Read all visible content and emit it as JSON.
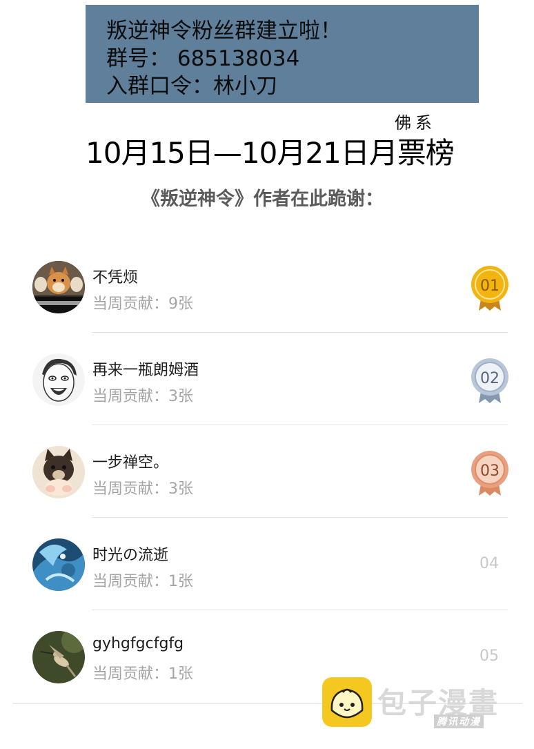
{
  "banner": {
    "line1": "叛逆神令粉丝群建立啦！",
    "line2": "群号： 685138034",
    "line3": "入群口令：林小刀"
  },
  "header": {
    "note": "佛系",
    "title": "10月15日—10月21日月票榜",
    "subtitle": "《叛逆神令》作者在此跪谢："
  },
  "leaderboard": [
    {
      "name": "不凭烦",
      "contribution": "当周贡献：9张",
      "rank": "01",
      "medal": "gold"
    },
    {
      "name": "再来一瓶朗姆酒",
      "contribution": "当周贡献：3张",
      "rank": "02",
      "medal": "silver"
    },
    {
      "name": "一步禅空。",
      "contribution": "当周贡献：3张",
      "rank": "03",
      "medal": "bronze"
    },
    {
      "name": "时光の流逝",
      "contribution": "当周贡献：1张",
      "rank": "04",
      "medal": "none"
    },
    {
      "name": "gyhgfgcfgfg",
      "contribution": "当周贡献：1张",
      "rank": "05",
      "medal": "none"
    }
  ],
  "colors": {
    "banner_bg": "#5f7f9a",
    "gold": "#f2b411",
    "silver": "#b9c6d8",
    "bronze": "#e9a07f",
    "logo_yellow": "#f4c820"
  },
  "watermark": {
    "brand": "包子漫畫",
    "sub": "腾讯动漫"
  }
}
